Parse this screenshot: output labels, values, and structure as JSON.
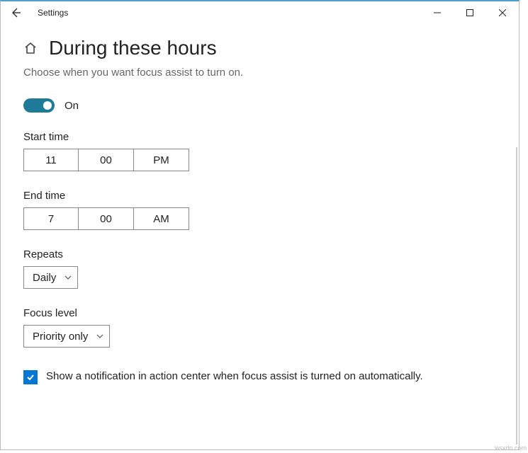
{
  "titlebar": {
    "app_title": "Settings"
  },
  "header": {
    "page_title": "During these hours",
    "subtitle": "Choose when you want focus assist to turn on."
  },
  "toggle": {
    "label": "On",
    "state": true
  },
  "start_time": {
    "label": "Start time",
    "hour": "11",
    "minute": "00",
    "ampm": "PM"
  },
  "end_time": {
    "label": "End time",
    "hour": "7",
    "minute": "00",
    "ampm": "AM"
  },
  "repeats": {
    "label": "Repeats",
    "value": "Daily"
  },
  "focus_level": {
    "label": "Focus level",
    "value": "Priority only"
  },
  "notification_checkbox": {
    "checked": true,
    "label": "Show a notification in action center when focus assist is turned on automatically."
  },
  "watermark": "wsxdn.com"
}
